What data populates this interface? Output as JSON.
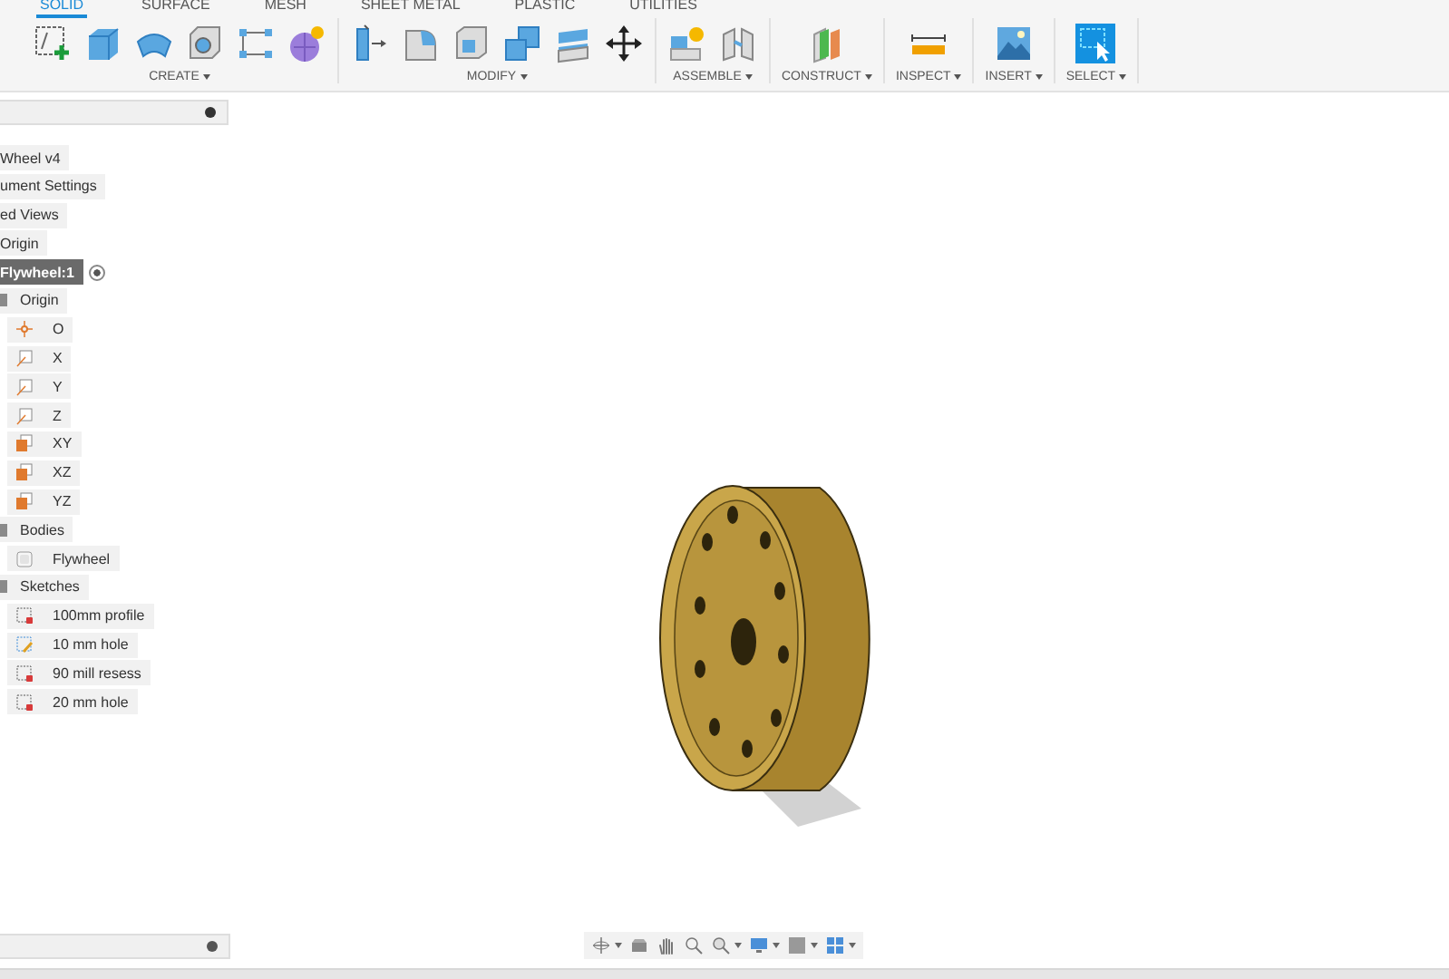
{
  "toolbar": {
    "tabs": [
      {
        "label": "SOLID",
        "selected": true
      },
      {
        "label": "SURFACE",
        "selected": false
      },
      {
        "label": "MESH",
        "selected": false
      },
      {
        "label": "SHEET METAL",
        "selected": false
      },
      {
        "label": "PLASTIC",
        "selected": false
      },
      {
        "label": "UTILITIES",
        "selected": false
      }
    ],
    "groups": [
      {
        "label": "CREATE"
      },
      {
        "label": "MODIFY"
      },
      {
        "label": "ASSEMBLE"
      },
      {
        "label": "CONSTRUCT"
      },
      {
        "label": "INSPECT"
      },
      {
        "label": "INSERT"
      },
      {
        "label": "SELECT"
      }
    ]
  },
  "browser": {
    "items": [
      {
        "label": "Wheel v4",
        "kind": "item",
        "selected": false
      },
      {
        "label": "ument Settings",
        "kind": "item",
        "selected": false
      },
      {
        "label": "ed Views",
        "kind": "item",
        "selected": false
      },
      {
        "label": "Origin",
        "kind": "item",
        "selected": false
      },
      {
        "label": "Flywheel:1",
        "kind": "component",
        "selected": true,
        "children": [
          {
            "label": "Origin",
            "kind": "folder",
            "selected": false,
            "children": [
              {
                "label": "O",
                "kind": "point",
                "selected": false
              },
              {
                "label": "X",
                "kind": "axis",
                "selected": false
              },
              {
                "label": "Y",
                "kind": "axis",
                "selected": false
              },
              {
                "label": "Z",
                "kind": "axis",
                "selected": false
              },
              {
                "label": "XY",
                "kind": "plane",
                "selected": false
              },
              {
                "label": "XZ",
                "kind": "plane",
                "selected": false
              },
              {
                "label": "YZ",
                "kind": "plane",
                "selected": false
              }
            ]
          },
          {
            "label": "Bodies",
            "kind": "folder",
            "selected": false,
            "children": [
              {
                "label": "Flywheel",
                "kind": "body",
                "selected": false
              }
            ]
          },
          {
            "label": "Sketches",
            "kind": "folder",
            "selected": false,
            "children": [
              {
                "label": "100mm profile",
                "kind": "sketch",
                "selected": false
              },
              {
                "label": "10 mm hole",
                "kind": "sketch-edit",
                "selected": false
              },
              {
                "label": "90 mill resess",
                "kind": "sketch",
                "selected": false
              },
              {
                "label": "20 mm hole",
                "kind": "sketch",
                "selected": false
              }
            ]
          }
        ]
      }
    ]
  }
}
